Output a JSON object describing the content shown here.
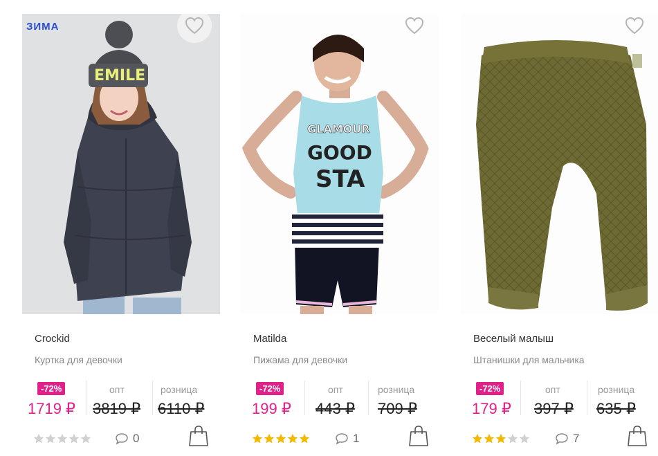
{
  "products": [
    {
      "season": "ЗИМА",
      "brand": "Crockid",
      "type": "Куртка для девочки",
      "discount": "-72%",
      "price": "1719 ₽",
      "opt_label": "опт",
      "opt_price": "3819 ₽",
      "retail_label": "розница",
      "retail_price": "6110 ₽",
      "rating": 0,
      "comments": "0"
    },
    {
      "brand": "Matilda",
      "type": "Пижама для девочки",
      "discount": "-72%",
      "price": "199 ₽",
      "opt_label": "опт",
      "opt_price": "443 ₽",
      "retail_label": "розница",
      "retail_price": "709 ₽",
      "rating": 5,
      "comments": "1"
    },
    {
      "brand": "Веселый малыш",
      "type": "Штанишки для мальчика",
      "discount": "-72%",
      "price": "179 ₽",
      "opt_label": "опт",
      "opt_price": "397 ₽",
      "retail_label": "розница",
      "retail_price": "635 ₽",
      "rating": 3,
      "comments": "7"
    }
  ],
  "colors": {
    "accent": "#e0218a",
    "season": "#2a4fd6",
    "star_on": "#f5b800",
    "star_off": "#d0d0d0"
  },
  "icons": {
    "favorite": "heart-icon",
    "comments": "comment-bubble-icon",
    "cart": "shopping-bag-icon",
    "rating": "star-icon"
  }
}
